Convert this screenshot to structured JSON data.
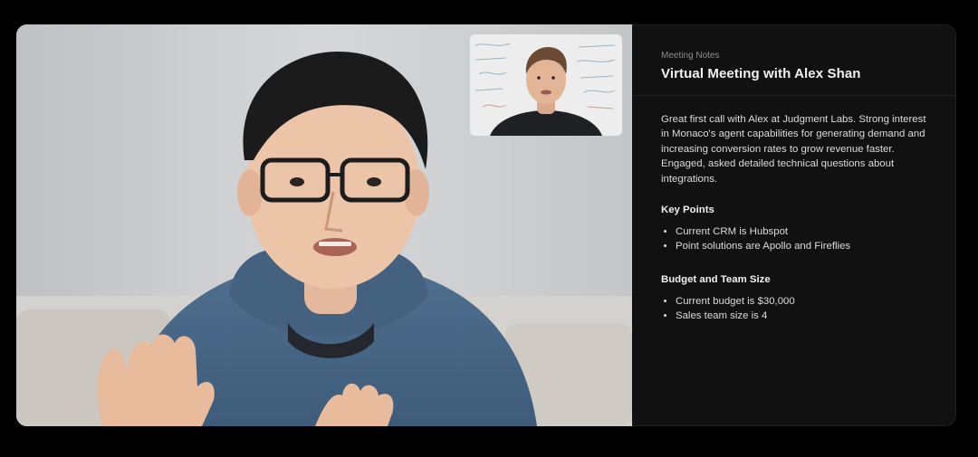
{
  "notes": {
    "eyebrow": "Meeting Notes",
    "title": "Virtual Meeting with Alex Shan",
    "summary": "Great first call with Alex at Judgment Labs. Strong interest in Monaco's agent capabilities for generating demand and increasing conversion rates to grow revenue faster. Engaged, asked detailed technical questions about integrations.",
    "sections": [
      {
        "heading": "Key Points",
        "items": [
          "Current CRM is Hubspot",
          "Point solutions are Apollo and Fireflies"
        ]
      },
      {
        "heading": "Budget and Team Size",
        "items": [
          "Current budget is $30,000",
          "Sales team size is 4"
        ]
      }
    ]
  },
  "colors": {
    "page_background": "#000000",
    "panel_background": "#111112",
    "divider": "#232326",
    "muted_text": "#8d8d93",
    "body_text": "#dcdcdf"
  }
}
